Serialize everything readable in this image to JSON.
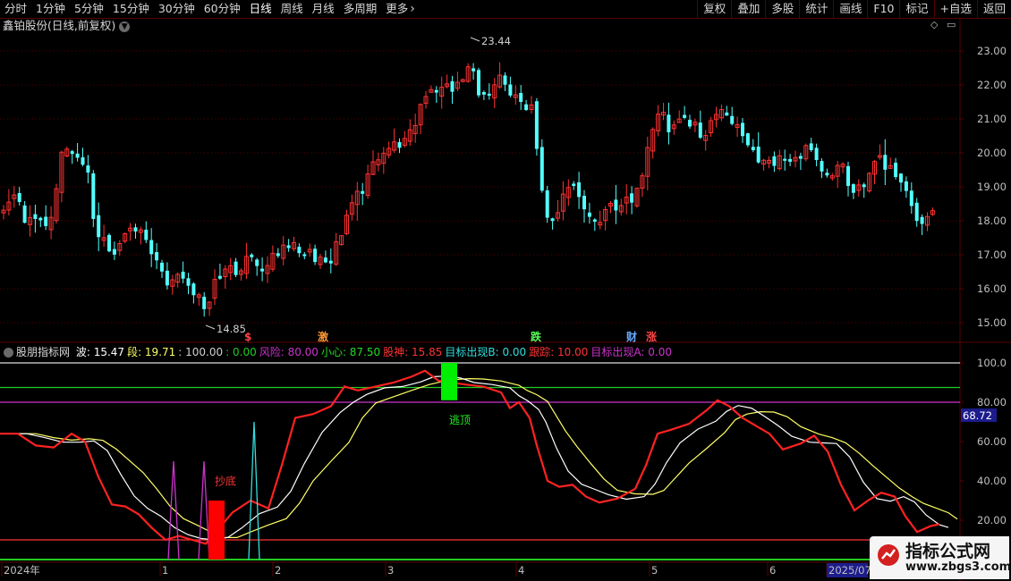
{
  "toolbar": {
    "periods": [
      "分时",
      "1分钟",
      "5分钟",
      "15分钟",
      "30分钟",
      "60分钟",
      "日线",
      "周线",
      "月线",
      "多周期",
      "更多"
    ],
    "active_period": "日线",
    "more_icon": "chevron-right-icon",
    "right_buttons": [
      "复权",
      "叠加",
      "多股",
      "统计",
      "画线",
      "F10",
      "标记",
      "+自选",
      "返回"
    ]
  },
  "main_chart": {
    "title": "鑫铂股份(日线,前复权)",
    "high_label": "23.44",
    "low_label": "14.85",
    "price_ticks": [
      "23.00",
      "22.00",
      "21.00",
      "20.00",
      "19.00",
      "18.00",
      "17.00",
      "16.00",
      "15.00"
    ],
    "markers": [
      "$",
      "激",
      "跌",
      "财",
      "涨"
    ]
  },
  "indicator": {
    "name": "股朋指标网",
    "items": [
      {
        "label": "波: ",
        "value": "15.47",
        "color": "#ffffff"
      },
      {
        "label": "段: ",
        "value": "19.71",
        "color": "#ffff66"
      },
      {
        "label": ": ",
        "value": "100.00",
        "color": "#d0d0d0"
      },
      {
        "label": ": ",
        "value": "0.00",
        "color": "#22cc22"
      },
      {
        "label": "风险: ",
        "value": "80.00",
        "color": "#cc33cc"
      },
      {
        "label": "小心: ",
        "value": "87.50",
        "color": "#22dd22"
      },
      {
        "label": "股神: ",
        "value": "15.85",
        "color": "#ff3333"
      },
      {
        "label": "目标出现B: ",
        "value": "0.00",
        "color": "#33dddd"
      },
      {
        "label": "跟踪: ",
        "value": "10.00",
        "color": "#ff3333"
      },
      {
        "label": "目标出现A: ",
        "value": "0.00",
        "color": "#cc33cc"
      }
    ],
    "ticks": [
      "100.0",
      "80.00",
      "60.00",
      "40.00",
      "20.00"
    ],
    "current_value": "68.72",
    "signal_bottom": "抄底",
    "signal_top": "逃顶"
  },
  "x_axis": {
    "labels": [
      "2024年",
      "1",
      "2",
      "3",
      "4",
      "5",
      "6",
      "2025/07"
    ]
  },
  "watermark": {
    "title": "指标公式网",
    "url": "www.zbgs3.com"
  },
  "colors": {
    "up": "#ff3232",
    "down": "#54ffff",
    "grid": "#5a0000",
    "axis_text": "#c0c0c0"
  }
}
